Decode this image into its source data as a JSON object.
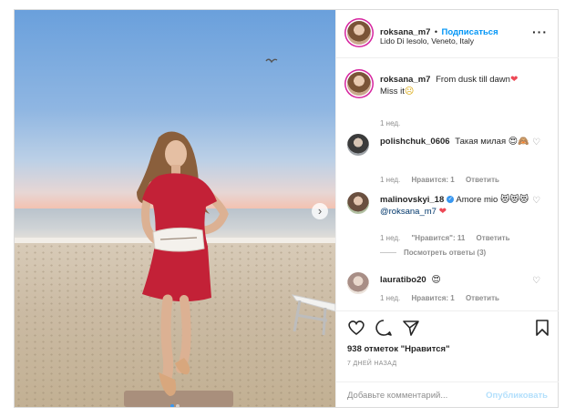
{
  "post": {
    "author": "roksana_m7",
    "follow_label": "Подписаться",
    "separator": "•",
    "location": "Lido Di Iesolo, Veneto, Italy",
    "more_icon": "more-horizontal-icon"
  },
  "caption": {
    "username": "roksana_m7",
    "text": "From dusk till dawn",
    "emoji_heart": "❤",
    "text2": "Miss it",
    "emoji_sad": "☹",
    "time": "1 нед."
  },
  "comments": [
    {
      "username": "polishchuk_0606",
      "text": "Такая милая",
      "emoji": "😍🙈",
      "time": "1 нед.",
      "likes": "Нравится: 1",
      "reply": "Ответить"
    },
    {
      "username": "malinovskyi_18",
      "text": "Amore mio",
      "emoji": "😻😻😻",
      "mention": "@roksana_m7",
      "emoji2": "❤",
      "time": "1 нед.",
      "likes": "\"Нравится\": 11",
      "reply": "Ответить",
      "view_replies": "Посмотреть ответы (3)"
    },
    {
      "username": "lauratibo20",
      "text": "",
      "emoji": "😍",
      "time": "1 нед.",
      "likes": "Нравится: 1",
      "reply": "Ответить"
    }
  ],
  "actions": {
    "likes_text": "938 отметок \"Нравится\"",
    "date": "7 ДНЕЙ НАЗАД"
  },
  "add_comment": {
    "placeholder": "Добавьте комментарий...",
    "publish_label": "Опубликовать"
  },
  "colors": {
    "accent": "#0095f6",
    "heart": "#ed4956",
    "muted": "#8e8e8e"
  }
}
